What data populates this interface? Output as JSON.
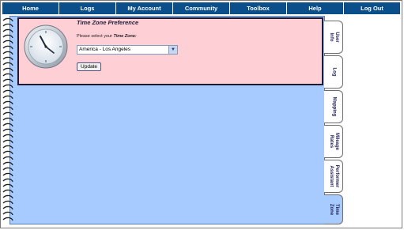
{
  "nav": {
    "items": [
      "Home",
      "Logs",
      "My Account",
      "Community",
      "Toolbox",
      "Help",
      "Log Out"
    ]
  },
  "preference": {
    "title": "Time Zone Preference",
    "prompt_prefix": "Please select your ",
    "prompt_emphasis": "Time Zone:",
    "selected_time_zone": "America - Los Angeles",
    "update_label": "Update"
  },
  "tabs": [
    {
      "label": "User\nInfo",
      "active": false
    },
    {
      "label": "Log",
      "active": false
    },
    {
      "label": "Mapping",
      "active": false
    },
    {
      "label": "Mileage\nRates",
      "active": false
    },
    {
      "label": "Performer\nAssistant",
      "active": false
    },
    {
      "label": "Time\nZone",
      "active": true
    }
  ],
  "colors": {
    "nav_bar": "#0b4f8a",
    "notebook_page": "#a8cbff",
    "preference_panel": "#ffcfd6"
  },
  "icons": {
    "select_arrow": "chevron-down-icon",
    "preference_image": "clock-icon"
  }
}
